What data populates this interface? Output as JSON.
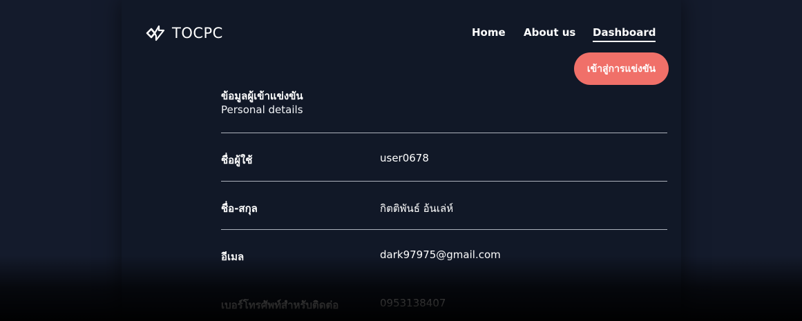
{
  "header": {
    "logo_text": "TOCPC",
    "nav": {
      "home": "Home",
      "about": "About us",
      "dashboard": "Dashboard"
    },
    "cta_label": "เข้าสู่การแข่งขัน"
  },
  "section": {
    "title": "ข้อมูลผู้เข้าแข่งขัน",
    "subtitle": "Personal details"
  },
  "details": [
    {
      "label": "ชื่อผู้ใช้",
      "value": "user0678"
    },
    {
      "label": "ชื่อ-สกุล",
      "value": "กิตติพันธ์ อ้นเล่ห์"
    },
    {
      "label": "อีเมล",
      "value": "dark97975@gmail.com"
    },
    {
      "label": "เบอร์โทรศัพท์สำหรับติดต่อ",
      "value": "0953138407"
    }
  ],
  "colors": {
    "background": "#141b2c",
    "panel": "#111827",
    "accent": "#f07069",
    "divider": "#aeb3bd"
  }
}
